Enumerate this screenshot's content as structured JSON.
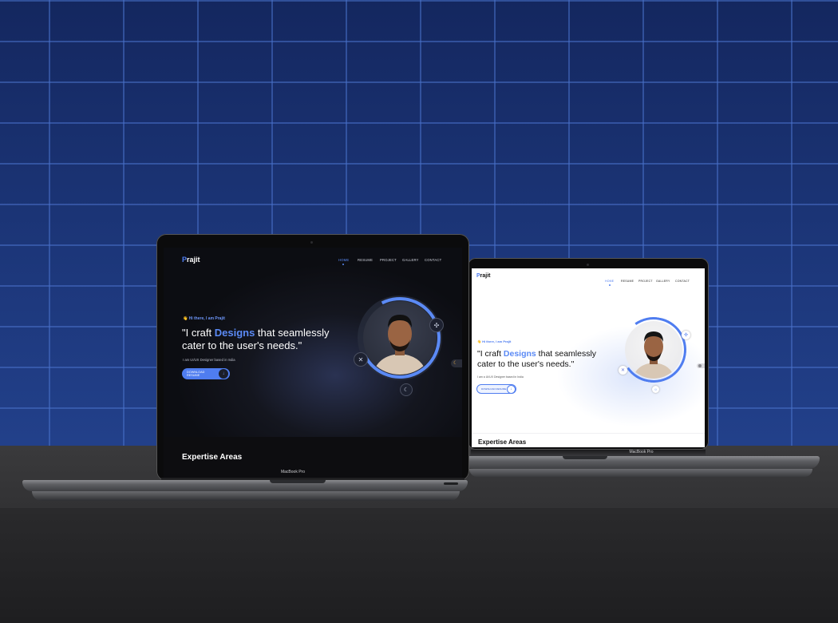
{
  "colors": {
    "accent": "#4f7df0",
    "wall": "#1c3679",
    "desk": "#3a3a3c"
  },
  "dark_site": {
    "logo_letter": "P",
    "logo_rest": "rajit",
    "nav": [
      "HOME",
      "RESUME",
      "PROJECT",
      "GALLERY",
      "CONTACT"
    ],
    "greeting": "👋 Hi there, I am Prajit",
    "headline_start": "\"I craft ",
    "headline_accent": "Designs",
    "headline_end": " that seamlessly cater to the user's needs.\"",
    "subtitle": "I am UI/UX Designer based in India",
    "cta": "DOWNLOAD RESUME",
    "section_title": "Expertise Areas",
    "device_label": "MacBook Pro"
  },
  "light_site": {
    "logo_letter": "P",
    "logo_rest": "rajit",
    "nav": [
      "HOME",
      "RESUME",
      "PROJECT",
      "GALLERY",
      "CONTACT"
    ],
    "greeting": "👋 Hi there, I am Prajit",
    "headline_start": "\"I craft ",
    "headline_accent": "Designs",
    "headline_end": " that seamlessly cater to the user's needs.\"",
    "subtitle": "I am a UI/UX Designer based in India",
    "cta": "DOWNLOAD RESUME",
    "section_title": "Expertise Areas",
    "device_label": "MacBook Pro"
  },
  "icons": [
    "figma-icon",
    "framer-icon",
    "moon-icon",
    "sun-icon",
    "toggle-icon",
    "download-icon"
  ]
}
